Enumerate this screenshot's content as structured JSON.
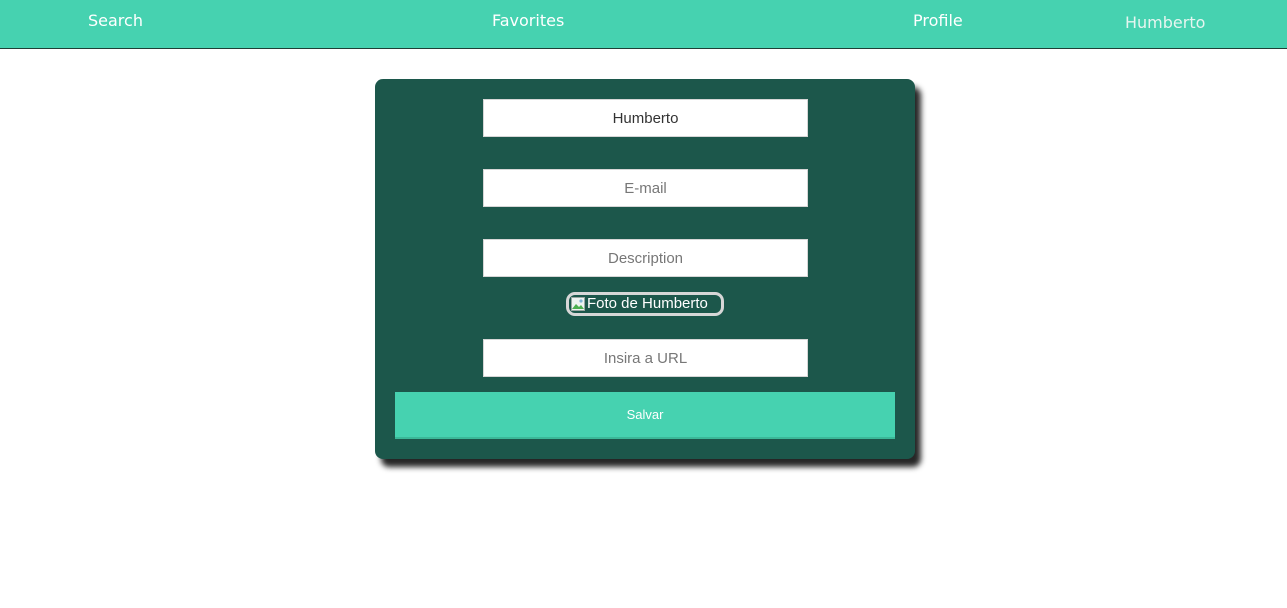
{
  "nav": {
    "search_label": "Search",
    "favorites_label": "Favorites",
    "profile_label": "Profile",
    "user_name": "Humberto"
  },
  "form": {
    "name_value": "Humberto",
    "email_placeholder": "E-mail",
    "description_placeholder": "Description",
    "photo_alt": "Foto de Humberto",
    "url_placeholder": "Insira a URL",
    "save_label": "Salvar"
  },
  "colors": {
    "accent": "#46d2b0",
    "card_background": "#1c574b"
  },
  "icons": {
    "photo": "broken-image-icon"
  }
}
